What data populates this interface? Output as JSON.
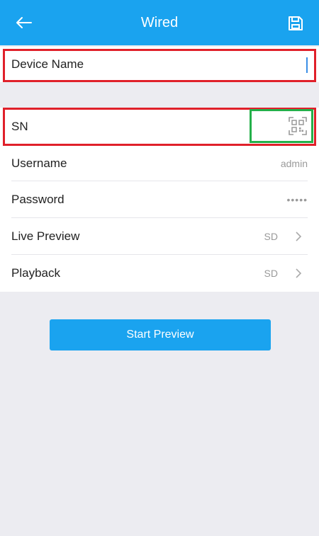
{
  "header": {
    "title": "Wired",
    "back_icon": "arrow-left-icon",
    "save_icon": "save-icon",
    "color": "#1aa3ef"
  },
  "form": {
    "device_name": {
      "placeholder": "Device Name",
      "value": ""
    },
    "sn": {
      "label": "SN",
      "scan_icon": "qr-code-scan-icon"
    },
    "username": {
      "label": "Username",
      "value": "admin"
    },
    "password": {
      "label": "Password",
      "value": "•••••"
    },
    "live_preview": {
      "label": "Live Preview",
      "value": "SD"
    },
    "playback": {
      "label": "Playback",
      "value": "SD"
    }
  },
  "actions": {
    "start_preview": "Start Preview"
  },
  "annotations": {
    "red_color": "#e0202a",
    "green_color": "#24b04a"
  }
}
